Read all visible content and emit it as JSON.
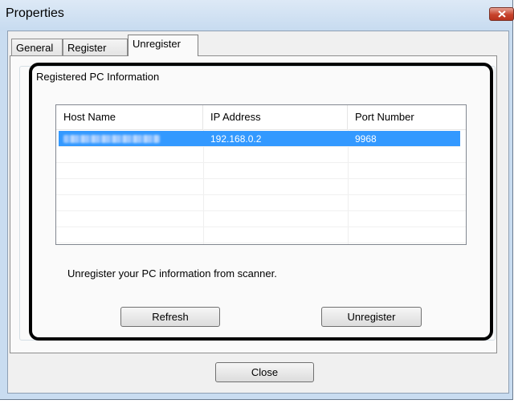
{
  "window": {
    "title": "Properties"
  },
  "tabs": [
    {
      "label": "General",
      "active": false
    },
    {
      "label": "Register",
      "active": false
    },
    {
      "label": "Unregister",
      "active": true
    }
  ],
  "group": {
    "title": "Registered PC Information",
    "columns": [
      "Host Name",
      "IP Address",
      "Port Number"
    ],
    "rows": [
      {
        "host_name": "",
        "ip_address": "192.168.0.2",
        "port_number": "9968",
        "selected": true
      }
    ],
    "info_text": "Unregister your PC information from scanner.",
    "refresh_label": "Refresh",
    "unregister_label": "Unregister"
  },
  "footer": {
    "close_label": "Close"
  },
  "icons": {
    "title_close": "close-icon"
  },
  "colors": {
    "selection": "#3399ff",
    "close_button": "#c7432c",
    "highlight_border": "#000000"
  }
}
